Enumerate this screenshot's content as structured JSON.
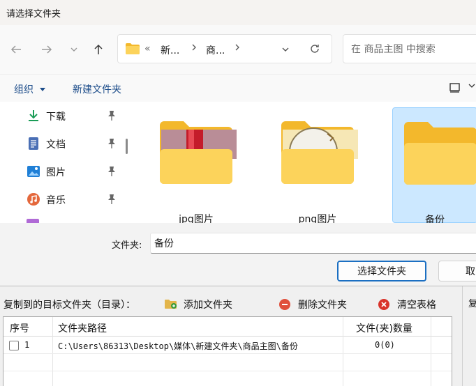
{
  "dialog": {
    "title": "请选择文件夹",
    "address": {
      "overflow": "«",
      "segments": [
        "新...",
        "商..."
      ]
    },
    "search_placeholder": "在 商品主图 中搜索",
    "commands": {
      "organize": "组织",
      "new_folder": "新建文件夹"
    },
    "nav_items": [
      {
        "label": "下载",
        "icon": "download-icon"
      },
      {
        "label": "文档",
        "icon": "document-icon"
      },
      {
        "label": "图片",
        "icon": "pictures-icon"
      },
      {
        "label": "音乐",
        "icon": "music-icon"
      }
    ],
    "files": [
      {
        "name": "jpg图片",
        "selected": false
      },
      {
        "name": "png图片",
        "selected": false
      },
      {
        "name": "备份",
        "selected": true
      }
    ],
    "folder_label": "文件夹:",
    "folder_value": "备份",
    "select_button": "选择文件夹",
    "cancel_button": "取"
  },
  "app": {
    "target_label": "复制到的目标文件夹（目录）：",
    "add_folder": "添加文件夹",
    "delete_folder": "删除文件夹",
    "clear_table": "清空表格",
    "right_label": "复",
    "columns": [
      "序号",
      "文件夹路径",
      "文件(夹)数量"
    ],
    "rows": [
      {
        "index": "1",
        "path": "C:\\Users\\86313\\Desktop\\媒体\\新建文件夹\\商品主图\\备份",
        "count": "0(0)"
      }
    ]
  },
  "colors": {
    "accent": "#1b6fc2",
    "selection": "#cce8ff",
    "folder": "#fcd35b"
  }
}
